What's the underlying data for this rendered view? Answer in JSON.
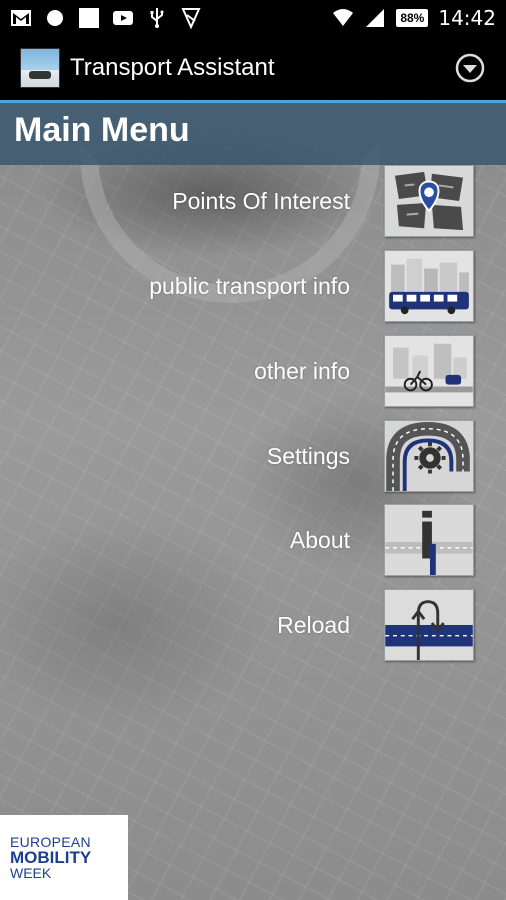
{
  "status_bar": {
    "time": "14:42",
    "battery": "88%"
  },
  "action_bar": {
    "title": "Transport Assistant"
  },
  "main_menu": {
    "title": "Main Menu",
    "items": [
      {
        "label": "Points Of Interest",
        "icon": "map-pin-icon"
      },
      {
        "label": "public transport info",
        "icon": "bus-icon"
      },
      {
        "label": "other info",
        "icon": "bicycle-icon"
      },
      {
        "label": "Settings",
        "icon": "gear-road-icon"
      },
      {
        "label": "About",
        "icon": "info-icon"
      },
      {
        "label": "Reload",
        "icon": "u-turn-icon"
      }
    ]
  },
  "logo": {
    "line1": "EUROPEAN",
    "line2": "MOBILITY",
    "line3": "WEEK"
  },
  "colors": {
    "accent": "#4da6d9",
    "header_bg": "#37556e",
    "logo_blue": "#1d3f8f"
  }
}
